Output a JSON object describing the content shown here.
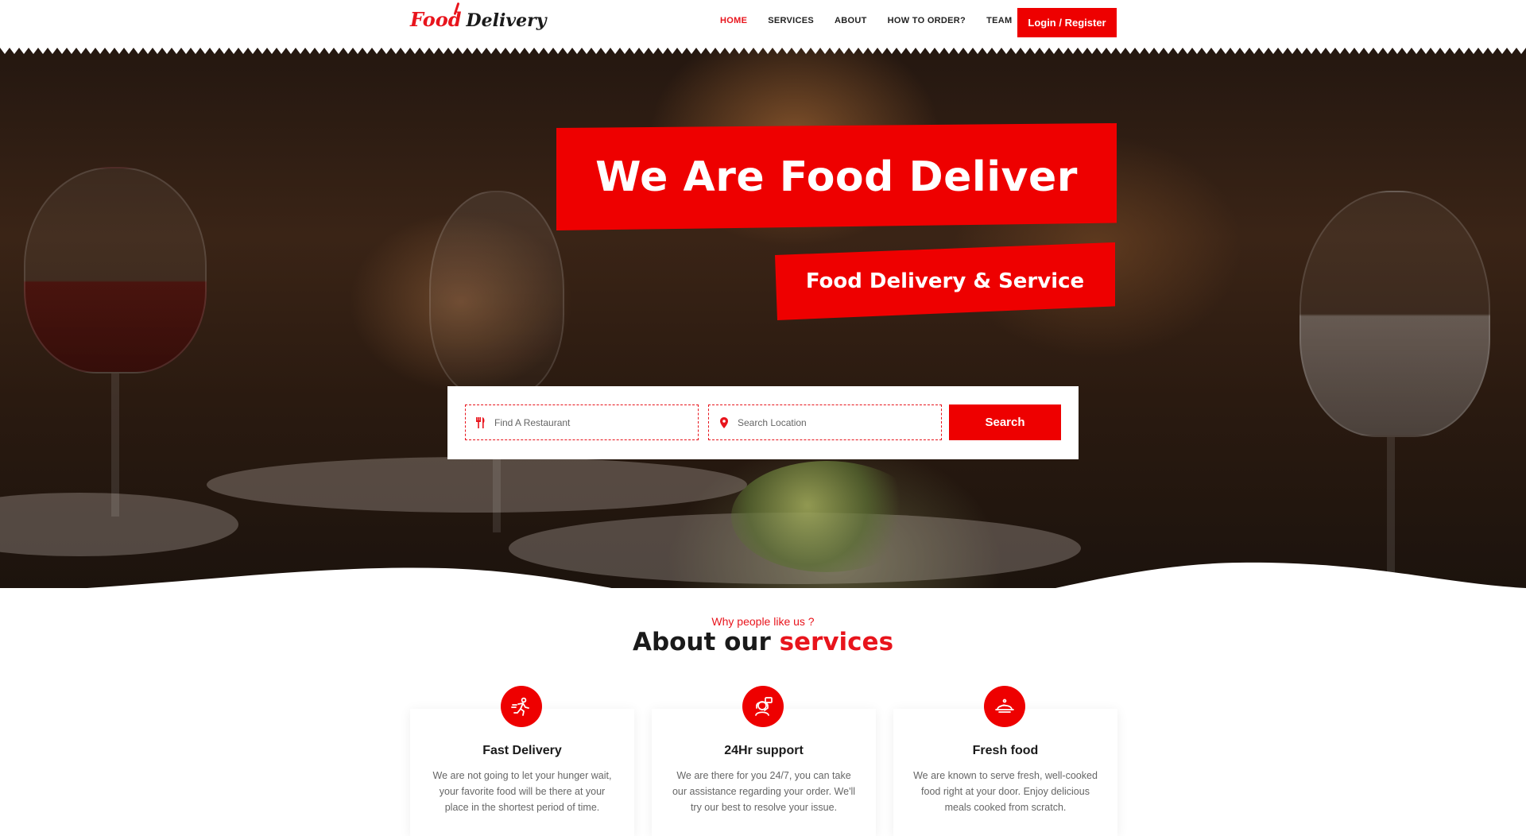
{
  "brand": {
    "name_part1": "Food",
    "name_part2": "Delivery"
  },
  "nav": {
    "items": [
      {
        "label": "HOME",
        "active": true
      },
      {
        "label": "SERVICES",
        "active": false
      },
      {
        "label": "ABOUT",
        "active": false
      },
      {
        "label": "HOW TO ORDER?",
        "active": false
      },
      {
        "label": "TEAM",
        "active": false
      }
    ],
    "login_label": "Login / Register"
  },
  "hero": {
    "headline": "We Are Food Deliver",
    "subheadline": "Food Delivery & Service"
  },
  "search": {
    "restaurant_placeholder": "Find A Restaurant",
    "restaurant_value": "",
    "location_placeholder": "Search Location",
    "location_value": "",
    "button_label": "Search"
  },
  "about": {
    "kicker": "Why people like us ?",
    "title_part1": "About our",
    "title_part2": "services",
    "cards": [
      {
        "icon": "running-delivery-icon",
        "title": "Fast Delivery",
        "text": "We are not going to let your hunger wait, your favorite food will be there at your place in the shortest period of time."
      },
      {
        "icon": "support-agent-icon",
        "title": "24Hr support",
        "text": "We are there for you 24/7, you can take our assistance regarding your order. We'll try our best to resolve your issue."
      },
      {
        "icon": "food-cloche-icon",
        "title": "Fresh food",
        "text": "We are known to serve fresh, well-cooked food right at your door. Enjoy delicious meals cooked from scratch."
      }
    ]
  },
  "colors": {
    "accent": "#ee0000",
    "text_dark": "#1a1a1a",
    "text_muted": "#666666"
  }
}
